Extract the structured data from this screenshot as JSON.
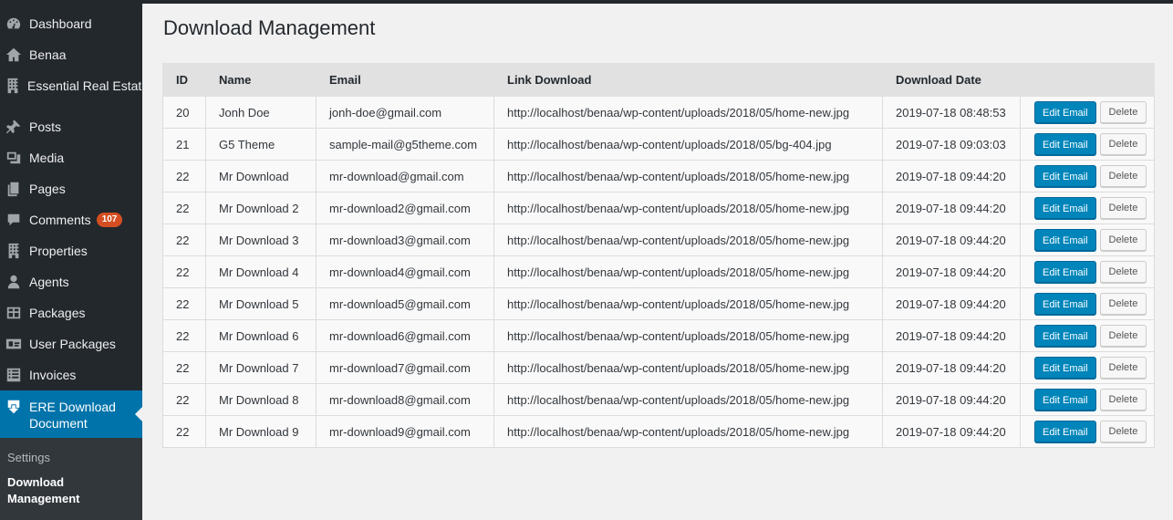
{
  "sidebar": {
    "items": [
      {
        "label": "Dashboard",
        "icon": "dashboard-icon"
      },
      {
        "label": "Benaa",
        "icon": "home-icon"
      },
      {
        "label": "Essential Real Estate",
        "icon": "building-icon"
      },
      {
        "label": "Posts",
        "icon": "pin-icon"
      },
      {
        "label": "Media",
        "icon": "media-icon"
      },
      {
        "label": "Pages",
        "icon": "pages-icon"
      },
      {
        "label": "Comments",
        "icon": "comment-icon",
        "badge": "107"
      },
      {
        "label": "Properties",
        "icon": "building-icon"
      },
      {
        "label": "Agents",
        "icon": "user-icon"
      },
      {
        "label": "Packages",
        "icon": "table-icon"
      },
      {
        "label": "User Packages",
        "icon": "id-card-icon"
      },
      {
        "label": "Invoices",
        "icon": "list-icon"
      }
    ],
    "active": {
      "label": "ERE Download Document",
      "icon": "download-icon"
    },
    "submenu": {
      "settings": "Settings",
      "current": "Download Management"
    }
  },
  "page": {
    "title": "Download Management"
  },
  "table": {
    "headers": [
      "ID",
      "Name",
      "Email",
      "Link Download",
      "Download Date",
      ""
    ],
    "rows": [
      {
        "id": "20",
        "name": "Jonh Doe",
        "email": "jonh-doe@gmail.com",
        "link": "http://localhost/benaa/wp-content/uploads/2018/05/home-new.jpg",
        "date": "2019-07-18 08:48:53"
      },
      {
        "id": "21",
        "name": "G5 Theme",
        "email": "sample-mail@g5theme.com",
        "link": "http://localhost/benaa/wp-content/uploads/2018/05/bg-404.jpg",
        "date": "2019-07-18 09:03:03"
      },
      {
        "id": "22",
        "name": "Mr Download",
        "email": "mr-download@gmail.com",
        "link": "http://localhost/benaa/wp-content/uploads/2018/05/home-new.jpg",
        "date": "2019-07-18 09:44:20"
      },
      {
        "id": "22",
        "name": "Mr Download 2",
        "email": "mr-download2@gmail.com",
        "link": "http://localhost/benaa/wp-content/uploads/2018/05/home-new.jpg",
        "date": "2019-07-18 09:44:20"
      },
      {
        "id": "22",
        "name": "Mr Download 3",
        "email": "mr-download3@gmail.com",
        "link": "http://localhost/benaa/wp-content/uploads/2018/05/home-new.jpg",
        "date": "2019-07-18 09:44:20"
      },
      {
        "id": "22",
        "name": "Mr Download 4",
        "email": "mr-download4@gmail.com",
        "link": "http://localhost/benaa/wp-content/uploads/2018/05/home-new.jpg",
        "date": "2019-07-18 09:44:20"
      },
      {
        "id": "22",
        "name": "Mr Download 5",
        "email": "mr-download5@gmail.com",
        "link": "http://localhost/benaa/wp-content/uploads/2018/05/home-new.jpg",
        "date": "2019-07-18 09:44:20"
      },
      {
        "id": "22",
        "name": "Mr Download 6",
        "email": "mr-download6@gmail.com",
        "link": "http://localhost/benaa/wp-content/uploads/2018/05/home-new.jpg",
        "date": "2019-07-18 09:44:20"
      },
      {
        "id": "22",
        "name": "Mr Download 7",
        "email": "mr-download7@gmail.com",
        "link": "http://localhost/benaa/wp-content/uploads/2018/05/home-new.jpg",
        "date": "2019-07-18 09:44:20"
      },
      {
        "id": "22",
        "name": "Mr Download 8",
        "email": "mr-download8@gmail.com",
        "link": "http://localhost/benaa/wp-content/uploads/2018/05/home-new.jpg",
        "date": "2019-07-18 09:44:20"
      },
      {
        "id": "22",
        "name": "Mr Download 9",
        "email": "mr-download9@gmail.com",
        "link": "http://localhost/benaa/wp-content/uploads/2018/05/home-new.jpg",
        "date": "2019-07-18 09:44:20"
      }
    ],
    "actions": {
      "edit_label": "Edit Email",
      "delete_label": "Delete"
    }
  },
  "colors": {
    "sidebar_bg": "#23282d",
    "active_bg": "#0073aa",
    "primary_button": "#0085ba",
    "badge": "#d54e21"
  }
}
